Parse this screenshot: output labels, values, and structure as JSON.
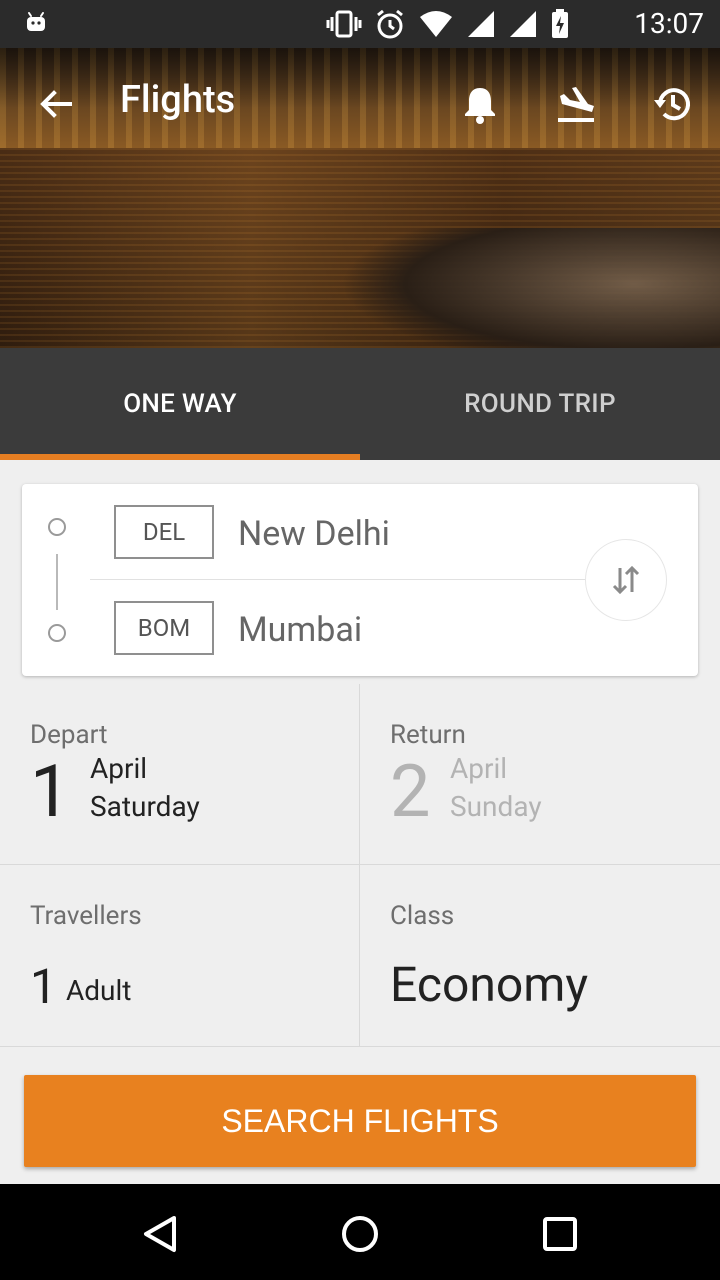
{
  "status_bar": {
    "time": "13:07",
    "icons": [
      "android-icon",
      "vibrate-icon",
      "alarm-icon",
      "wifi-icon",
      "signal-icon",
      "battery-charging-icon"
    ]
  },
  "appbar": {
    "title": "Flights",
    "actions": [
      "back-icon",
      "notifications-icon",
      "flight-land-icon",
      "history-icon"
    ]
  },
  "tabs": {
    "one_way": "ONE WAY",
    "round_trip": "ROUND TRIP",
    "selected": "one_way",
    "accent_color": "#e67e22"
  },
  "route": {
    "from": {
      "code": "DEL",
      "city": "New Delhi"
    },
    "to": {
      "code": "BOM",
      "city": "Mumbai"
    }
  },
  "depart": {
    "label": "Depart",
    "day": "1",
    "month": "April",
    "weekday": "Saturday"
  },
  "return": {
    "label": "Return",
    "day": "2",
    "month": "April",
    "weekday": "Sunday"
  },
  "travellers": {
    "label": "Travellers",
    "count": "1",
    "unit": "Adult"
  },
  "class": {
    "label": "Class",
    "value": "Economy"
  },
  "search_button": {
    "label": "SEARCH FLIGHTS",
    "color": "#e8811f"
  },
  "navbar": {
    "icons": [
      "back-triangle-icon",
      "home-circle-icon",
      "recents-square-icon"
    ]
  }
}
